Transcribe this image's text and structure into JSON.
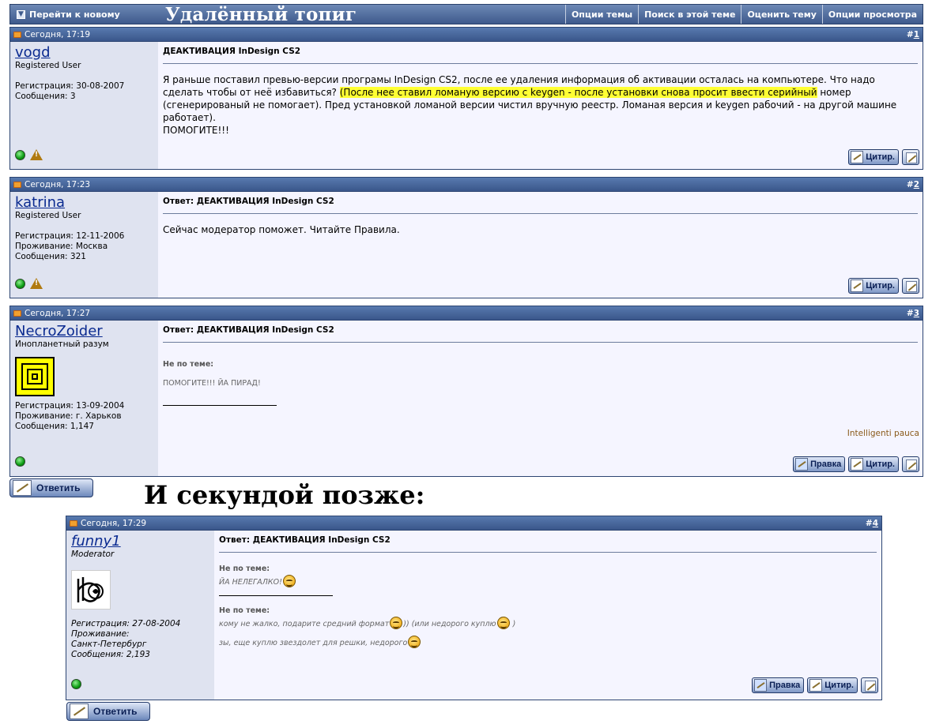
{
  "topbar": {
    "goto_new": "Перейти к новому",
    "title": "Удалённый топиг",
    "menu": [
      "Опции темы",
      "Поиск в этой теме",
      "Оценить тему",
      "Опции просмотра"
    ]
  },
  "posts": [
    {
      "date": "Сегодня, 17:19",
      "num": "1",
      "username": "vogd",
      "usertitle": "Registered User",
      "info": [
        "Регистрация: 30-08-2007",
        "Сообщения: 3"
      ],
      "title": "ДЕАКТИВАЦИЯ InDesign CS2",
      "message_before": "Я раньше поставил превью-версии програмы InDesign CS2, после ее удаления информация об активации осталась на компьютере. Что надо сделать чтобы от неё избавиться? ",
      "message_highlight": "(После нее ставил ломаную версию с keygen - после установки снова просит ввести серийный",
      "message_after": " номер (сгенерированый не помогает). Пред установкой ломаной версии чистил вручную реестр. Ломаная версия и keygen рабочий - на другой машине работает).",
      "message_last": "ПОМОГИТЕ!!!"
    },
    {
      "date": "Сегодня, 17:23",
      "num": "2",
      "username": "katrina",
      "usertitle": "Registered User",
      "info": [
        "Регистрация: 12-11-2006",
        "Проживание: Москва",
        "Сообщения: 321"
      ],
      "title": "Ответ: ДЕАКТИВАЦИЯ InDesign CS2",
      "message": "Сейчас модератор поможет. Читайте Правила."
    },
    {
      "date": "Сегодня, 17:27",
      "num": "3",
      "username": "NecroZoider",
      "usertitle": "Инопланетный разум",
      "info": [
        "Регистрация: 13-09-2004",
        "Проживание: г. Харьков",
        "Сообщения: 1,147"
      ],
      "title": "Ответ: ДЕАКТИВАЦИЯ InDesign CS2",
      "offtopic_label": "Не по теме:",
      "offtopic_text": "ПОМОГИТЕ!!! ЙА ПИРАД!",
      "signature": "Intelligenti pauca"
    },
    {
      "date": "Сегодня, 17:29",
      "num": "4",
      "username": "funny1",
      "usertitle": "Moderator",
      "info": [
        "Регистрация: 27-08-2004",
        "Проживание:",
        "Санкт-Петербург",
        "Сообщения: 2,193"
      ],
      "title": "Ответ: ДЕАКТИВАЦИЯ InDesign CS2",
      "offtopic_label": "Не по теме:",
      "offtopic_text": "ЙА НЕЛЕГАЛКО!",
      "offtopic_label2": "Не по теме:",
      "line1_a": "кому не жалко, подарите средний формат",
      "line1_b": ")) (или недорого куплю",
      "line1_c": " )",
      "line2": "зы, еще куплю звездолет для решки, недорого"
    }
  ],
  "labels": {
    "hash": "#",
    "quote": "Цитир.",
    "edit": "Правка",
    "reply": "Ответить"
  },
  "caption": "И секундой позже:"
}
